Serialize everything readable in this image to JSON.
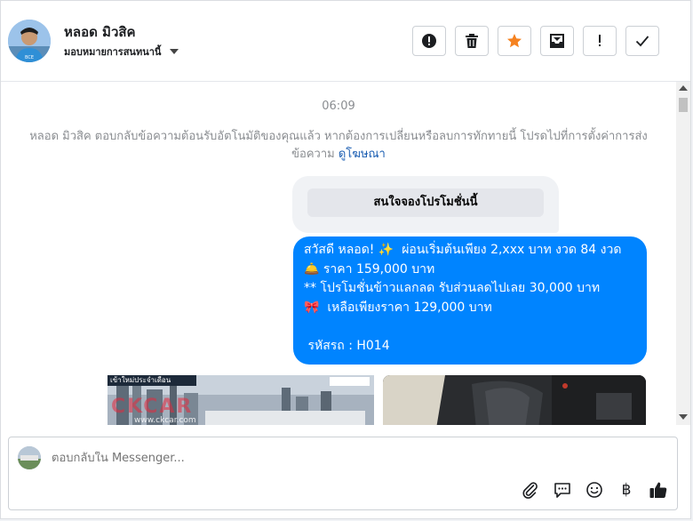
{
  "header": {
    "name": "หลอด มิวสิค",
    "assign_label": "มอบหมายการสนทนานี้",
    "buttons": [
      {
        "name": "spam-button",
        "icon": "exclamation-circle-icon"
      },
      {
        "name": "delete-button",
        "icon": "trash-icon"
      },
      {
        "name": "star-button",
        "icon": "star-icon"
      },
      {
        "name": "archive-button",
        "icon": "archive-icon"
      },
      {
        "name": "follow-up-button",
        "icon": "exclamation-icon"
      },
      {
        "name": "done-button",
        "icon": "check-icon"
      }
    ],
    "star_color": "#f58220"
  },
  "chat": {
    "time": "06:09",
    "notice_text": "หลอด มิวสิค ตอบกลับข้อความต้อนรับอัตโนมัติของคุณแล้ว หากต้องการเปลี่ยนหรือลบการทักทายนี้ โปรดไปที่การตั้งค่าการส่งข้อความ",
    "notice_link": "ดูโฆษณา",
    "quick_reply": "สนใจจองโปรโมชั่นนี้",
    "message_lines": [
      "สวัสดี หลอด! ✨  ผ่อนเริ่มต้นเพียง 2,xxx บาท งวด 84 งวด",
      "🛎️ ราคา 159,000 บาท",
      "** โปรโมชั่นข้าวแลกลด รับส่วนลดไปเลย 30,000 บาท",
      "🎀  เหลือเพียงราคา 129,000 บาท",
      "",
      " รหัสรถ : H014"
    ],
    "bubble_color": "#0084ff",
    "image_caption": "www.ckcar.com",
    "image_watermark": "CKCAR",
    "image_banner": "เข้าใหม่ประจำเดือน"
  },
  "composer": {
    "placeholder": "ตอบกลับใน Messenger...",
    "tools": [
      "paperclip-icon",
      "chat-bubble-icon",
      "smiley-icon",
      "baht-icon",
      "thumbs-up-icon"
    ],
    "baht_symbol": "฿"
  }
}
